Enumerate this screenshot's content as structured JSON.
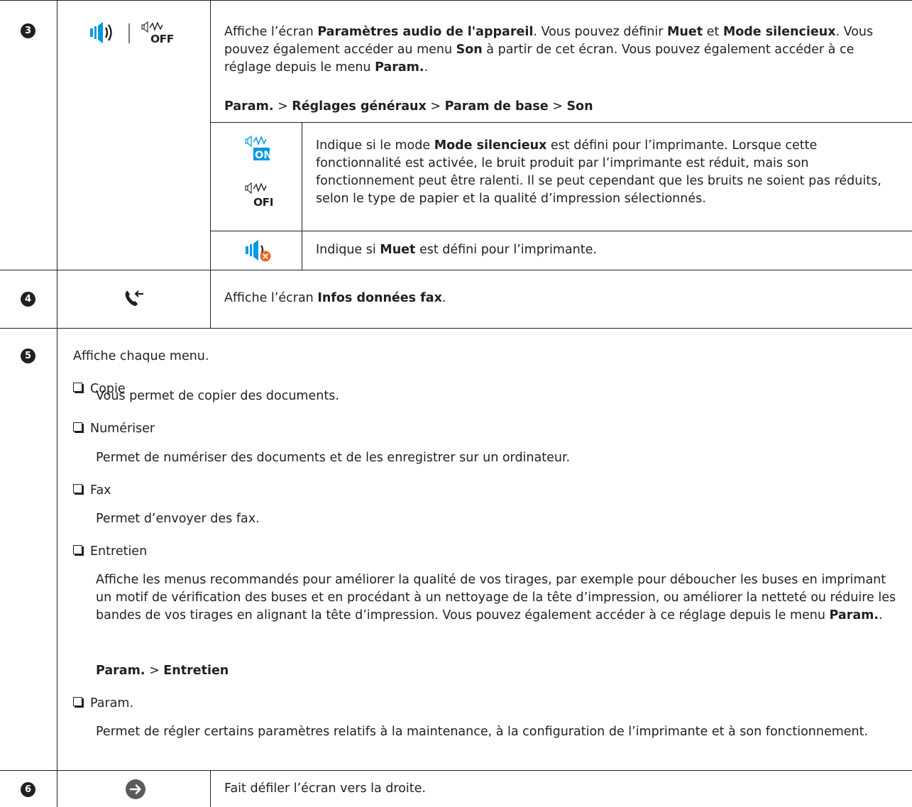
{
  "row3": {
    "number": "3",
    "desc_prefix": "Affiche l’écran ",
    "desc_bold1": "Paramètres audio de l'appareil",
    "desc_mid1": ". Vous pouvez définir ",
    "desc_bold2": "Muet",
    "desc_mid2": " et ",
    "desc_bold3": "Mode silencieux",
    "desc_mid3": ". Vous pouvez également accéder au menu ",
    "desc_bold4": "Son",
    "desc_mid4": " à partir de cet écran. Vous pouvez également accéder à ce réglage depuis le menu ",
    "desc_bold5": "Param.",
    "desc_end": ".",
    "path": {
      "p1": "Param.",
      "sep": " > ",
      "p2": "Réglages généraux",
      "p3": "Param de base",
      "p4": "Son"
    },
    "icon_on_text": "ON",
    "icon_off_text": "OFF",
    "sub1_prefix": "Indique si le mode ",
    "sub1_bold": "Mode silencieux",
    "sub1_rest": " est défini pour l’imprimante. Lorsque cette fonctionnalité est activée, le bruit produit par l’imprimante est réduit, mais son fonctionnement peut être ralenti. Il se peut cependant que les bruits ne soient pas réduits, selon le type de papier et la qualité d’impression sélectionnés.",
    "sub2_prefix": "Indique si ",
    "sub2_bold": "Muet",
    "sub2_rest": " est défini pour l’imprimante."
  },
  "row4": {
    "number": "4",
    "desc_prefix": "Affiche l’écran ",
    "desc_bold": "Infos données fax",
    "desc_end": "."
  },
  "row5": {
    "number": "5",
    "intro": "Affiche chaque menu.",
    "items": [
      {
        "label": "Copie",
        "desc": "Vous permet de copier des documents."
      },
      {
        "label": "Numériser",
        "desc": "Permet de numériser des documents et de les enregistrer sur un ordinateur."
      },
      {
        "label": "Fax",
        "desc": "Permet d’envoyer des fax."
      },
      {
        "label": "Entretien",
        "desc": "Affiche les menus recommandés pour améliorer la qualité de vos tirages, par exemple pour déboucher les buses en imprimant un motif de vérification des buses et en procédant à un nettoyage de la tête d’impression, ou améliorer la netteté ou réduire les bandes de vos tirages en alignant la tête d’impression. Vous pouvez également accéder à ce réglage depuis le menu ",
        "desc_bold": "Param.",
        "desc_end": "."
      },
      {
        "label": "Param.",
        "desc": "Permet de régler certains paramètres relatifs à la maintenance, à la configuration de l’imprimante et à son fonctionnement."
      }
    ],
    "path": {
      "p1": "Param.",
      "sep": " > ",
      "p2": "Entretien"
    }
  },
  "row6": {
    "number": "6",
    "desc": "Fait défiler l’écran vers la droite."
  },
  "colors": {
    "border": "#231f20",
    "icon_blue": "#0099e0",
    "icon_orange": "#f26522",
    "arrow_gray": "#5b5b5b"
  }
}
